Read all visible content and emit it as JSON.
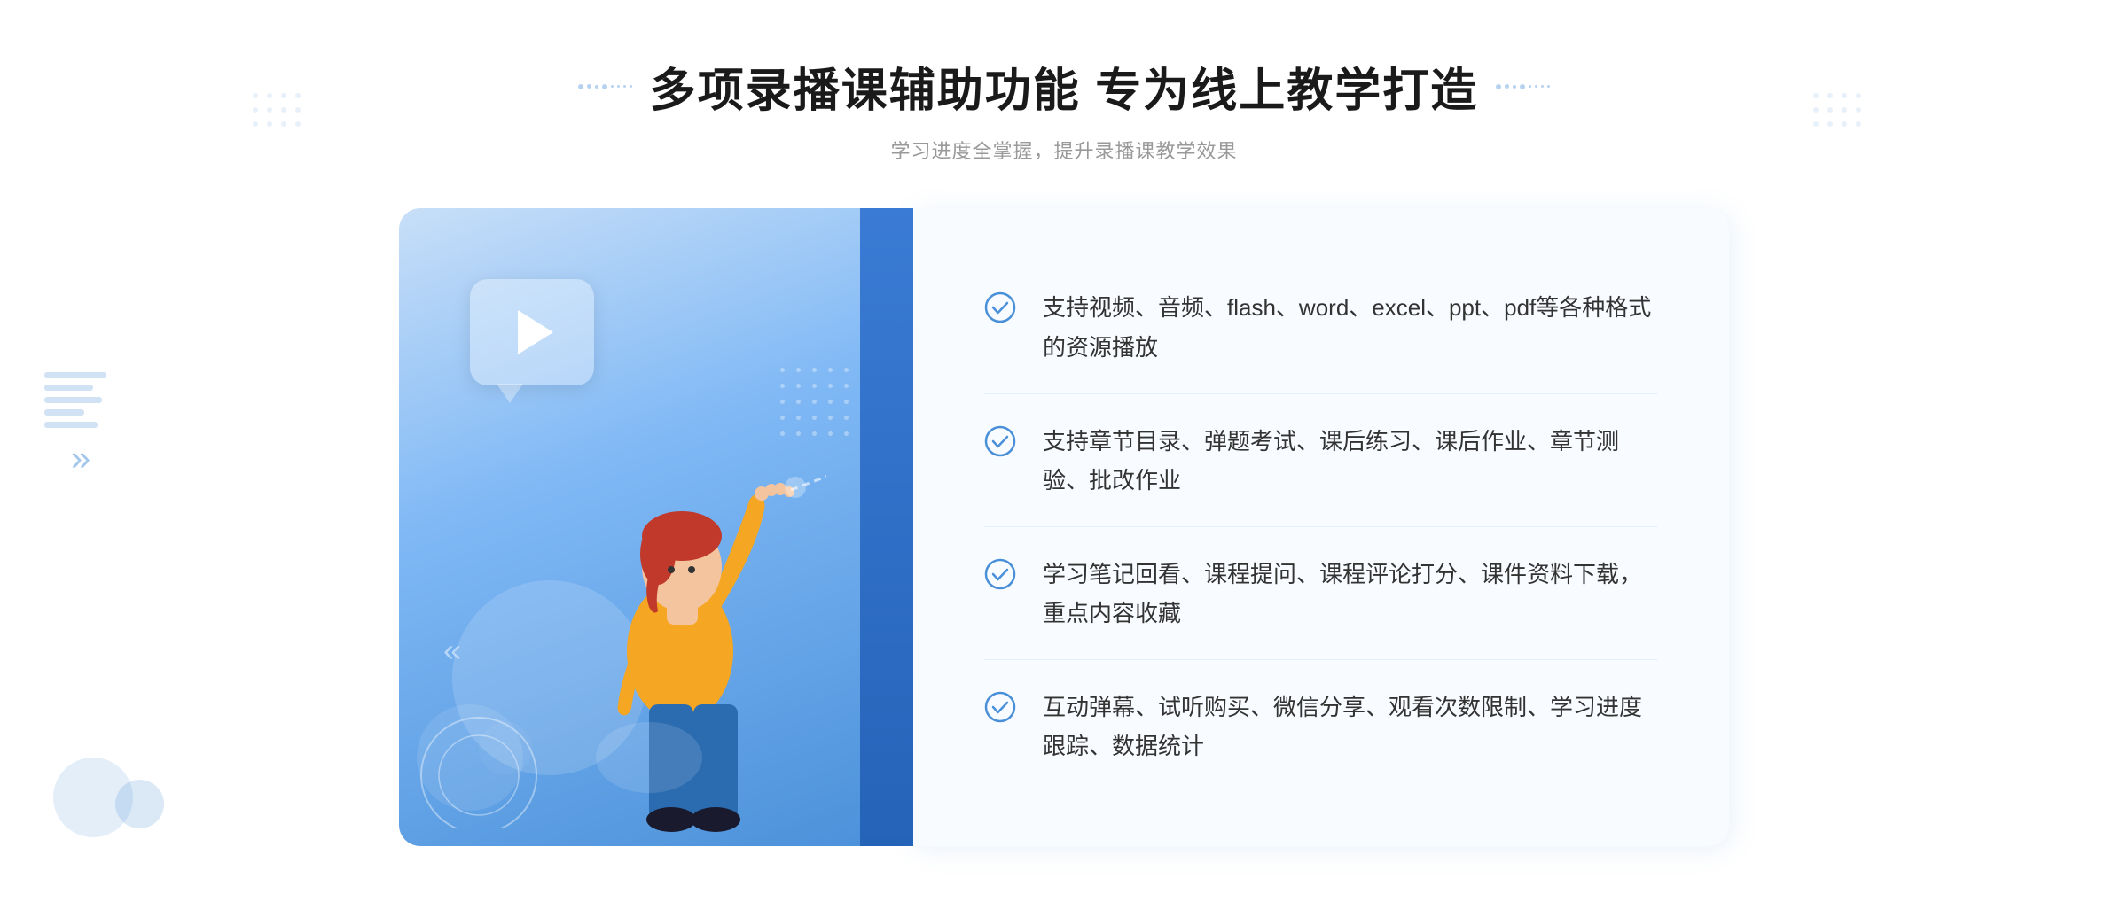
{
  "header": {
    "title": "多项录播课辅助功能 专为线上教学打造",
    "subtitle": "学习进度全掌握，提升录播课教学效果"
  },
  "features": [
    {
      "id": "feature-1",
      "text": "支持视频、音频、flash、word、excel、ppt、pdf等各种格式的资源播放"
    },
    {
      "id": "feature-2",
      "text": "支持章节目录、弹题考试、课后练习、课后作业、章节测验、批改作业"
    },
    {
      "id": "feature-3",
      "text": "学习笔记回看、课程提问、课程评论打分、课件资料下载，重点内容收藏"
    },
    {
      "id": "feature-4",
      "text": "互动弹幕、试听购买、微信分享、观看次数限制、学习进度跟踪、数据统计"
    }
  ],
  "accent_color": "#4a90d9",
  "check_color": "#4a90d9"
}
